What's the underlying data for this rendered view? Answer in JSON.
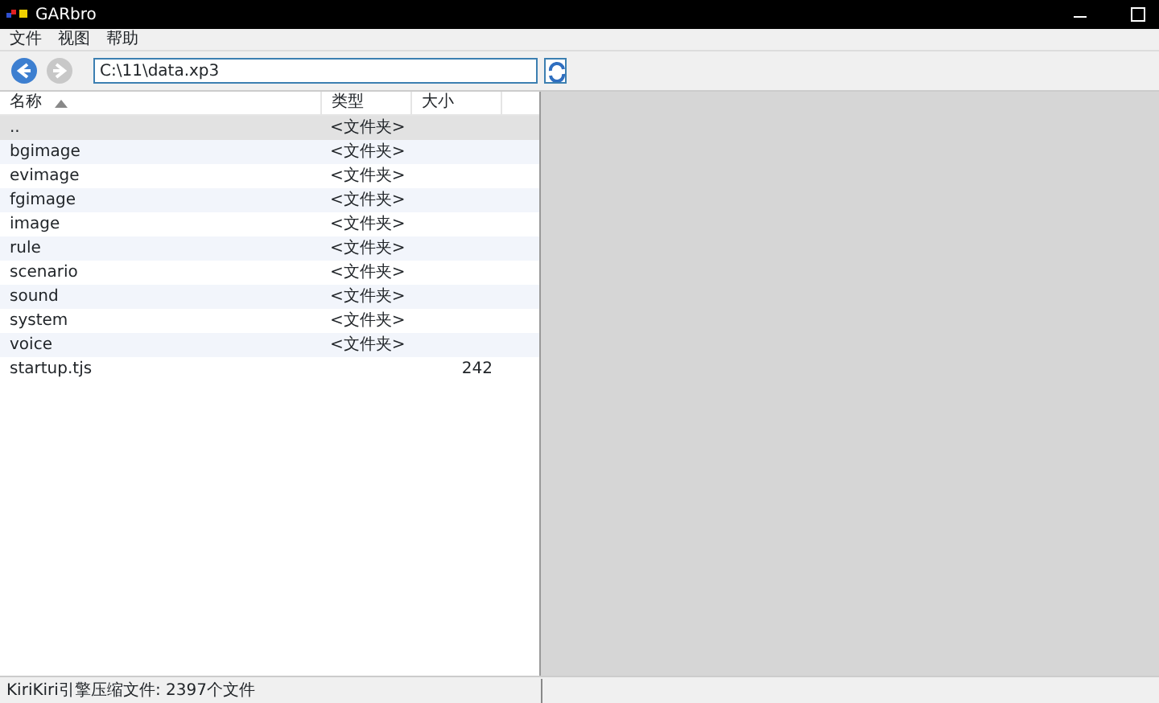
{
  "window": {
    "title": "GARbro"
  },
  "menu": [
    "文件",
    "视图",
    "帮助"
  ],
  "toolbar": {
    "back_disabled": false,
    "forward_disabled": true,
    "path": "C:\\11\\data.xp3"
  },
  "table": {
    "columns": [
      {
        "label": "名称",
        "sorted": true
      },
      {
        "label": "类型",
        "sorted": false
      },
      {
        "label": "大小",
        "sorted": false
      }
    ],
    "rows": [
      {
        "name": "..",
        "type": "<文件夹>",
        "selected": true
      },
      {
        "name": "bgimage",
        "type": "<文件夹>",
        "selected": false
      },
      {
        "name": "evimage",
        "type": "<文件夹>",
        "selected": false
      },
      {
        "name": "fgimage",
        "type": "<文件夹>",
        "selected": false
      },
      {
        "name": "image",
        "type": "<文件夹>",
        "selected": false
      },
      {
        "name": "rule",
        "type": "<文件夹>",
        "selected": false
      },
      {
        "name": "scenario",
        "type": "<文件夹>",
        "selected": false
      },
      {
        "name": "sound",
        "type": "<文件夹>",
        "selected": false
      },
      {
        "name": "system",
        "type": "<文件夹>",
        "selected": false
      },
      {
        "name": "voice",
        "type": "<文件夹>",
        "selected": false
      },
      {
        "name": "startup.tjs",
        "size": "242",
        "selected": false
      }
    ]
  },
  "status_bar": "KiriKiri引擎压缩文件: 2397个文件"
}
